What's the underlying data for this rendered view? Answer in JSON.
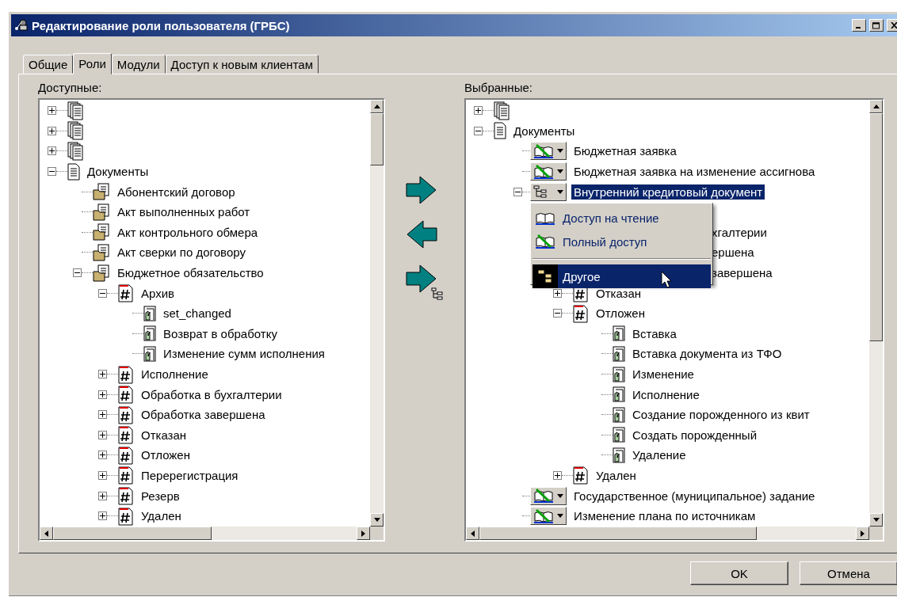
{
  "window": {
    "title": "Редактирование роли пользователя (ГРБС)"
  },
  "tabs": [
    {
      "label": "Общие",
      "selected": false
    },
    {
      "label": "Роли",
      "selected": true
    },
    {
      "label": "Модули",
      "selected": false
    },
    {
      "label": "Доступ к новым клиентам",
      "selected": false
    }
  ],
  "available": {
    "label": "Доступные:",
    "nodes": [
      {
        "kind": "stack",
        "expanded": false
      },
      {
        "kind": "stack",
        "expanded": false
      },
      {
        "kind": "stack",
        "expanded": false
      },
      {
        "kind": "doc",
        "label": "Документы",
        "expanded": true,
        "children": [
          {
            "kind": "folder",
            "label": "Абонентский договор"
          },
          {
            "kind": "folder",
            "label": "Акт выполненных работ"
          },
          {
            "kind": "folder",
            "label": "Акт контрольного обмера"
          },
          {
            "kind": "folder",
            "label": "Акт сверки по договору"
          },
          {
            "kind": "folder",
            "label": "Бюджетное обязательство",
            "expanded": true,
            "children": [
              {
                "kind": "state",
                "label": "Архив",
                "expanded": true,
                "children": [
                  {
                    "kind": "action",
                    "label": "set_changed"
                  },
                  {
                    "kind": "action",
                    "label": "Возврат в обработку"
                  },
                  {
                    "kind": "action",
                    "label": "Изменение сумм исполнения"
                  }
                ]
              },
              {
                "kind": "state",
                "label": "Исполнение",
                "expanded": false
              },
              {
                "kind": "state",
                "label": "Обработка в бухгалтерии",
                "expanded": false
              },
              {
                "kind": "state",
                "label": "Обработка завершена",
                "expanded": false
              },
              {
                "kind": "state",
                "label": "Отказан",
                "expanded": false
              },
              {
                "kind": "state",
                "label": "Отложен",
                "expanded": false
              },
              {
                "kind": "state",
                "label": "Перерегистрация",
                "expanded": false
              },
              {
                "kind": "state",
                "label": "Резерв",
                "expanded": false
              },
              {
                "kind": "state",
                "label": "Удален",
                "expanded": false
              }
            ]
          }
        ]
      }
    ]
  },
  "transfer_buttons": [
    {
      "kind": "add"
    },
    {
      "kind": "remove"
    },
    {
      "kind": "add_tree"
    }
  ],
  "selected_roles": {
    "label": "Выбранные:",
    "nodes": [
      {
        "kind": "stack",
        "expanded": false
      },
      {
        "kind": "doc",
        "label": "Документы",
        "expanded": true,
        "selected": false,
        "children": [
          {
            "kind": "access_full",
            "label": "Бюджетная заявка",
            "selected": false
          },
          {
            "kind": "access_full",
            "label": "Бюджетная заявка на изменение ассигнова",
            "selected": false
          },
          {
            "kind": "access_other",
            "label": "Внутренний кредитовый документ",
            "selected": true,
            "expanded": true,
            "menu": [
              {
                "kind": "read",
                "label": "Доступ на чтение",
                "selected": false
              },
              {
                "kind": "full",
                "label": "Полный доступ",
                "selected": false
              },
              {
                "kind": "other",
                "label": "Другое",
                "selected": true
              }
            ],
            "children": [
              {
                "kind": "covered"
              },
              {
                "kind": "covered",
                "label": "хгалтерии"
              },
              {
                "kind": "covered",
                "label": "ершена"
              },
              {
                "kind": "covered",
                "label": "завершена"
              },
              {
                "kind": "state",
                "label": "Отказан",
                "expanded": false,
                "selected": false
              },
              {
                "kind": "state",
                "label": "Отложен",
                "expanded": true,
                "selected": false,
                "children": [
                  {
                    "kind": "action",
                    "label": "Вставка",
                    "selected": false
                  },
                  {
                    "kind": "action",
                    "label": "Вставка документа из ТФО",
                    "selected": false
                  },
                  {
                    "kind": "action",
                    "label": "Изменение",
                    "selected": false
                  },
                  {
                    "kind": "action",
                    "label": "Исполнение",
                    "selected": false
                  },
                  {
                    "kind": "action",
                    "label": "Создание порожденного из квит",
                    "selected": false
                  },
                  {
                    "kind": "action",
                    "label": "Создать порожденный",
                    "selected": false
                  },
                  {
                    "kind": "action",
                    "label": "Удаление",
                    "selected": false
                  }
                ]
              },
              {
                "kind": "state",
                "label": "Удален",
                "expanded": false,
                "selected": false
              }
            ]
          },
          {
            "kind": "access_full",
            "label": "Государственное (муниципальное) задание",
            "selected": false
          },
          {
            "kind": "access_full",
            "label": "Изменение плана по источникам",
            "selected": false
          }
        ]
      }
    ]
  },
  "buttons": [
    "OK",
    "Отмена"
  ]
}
